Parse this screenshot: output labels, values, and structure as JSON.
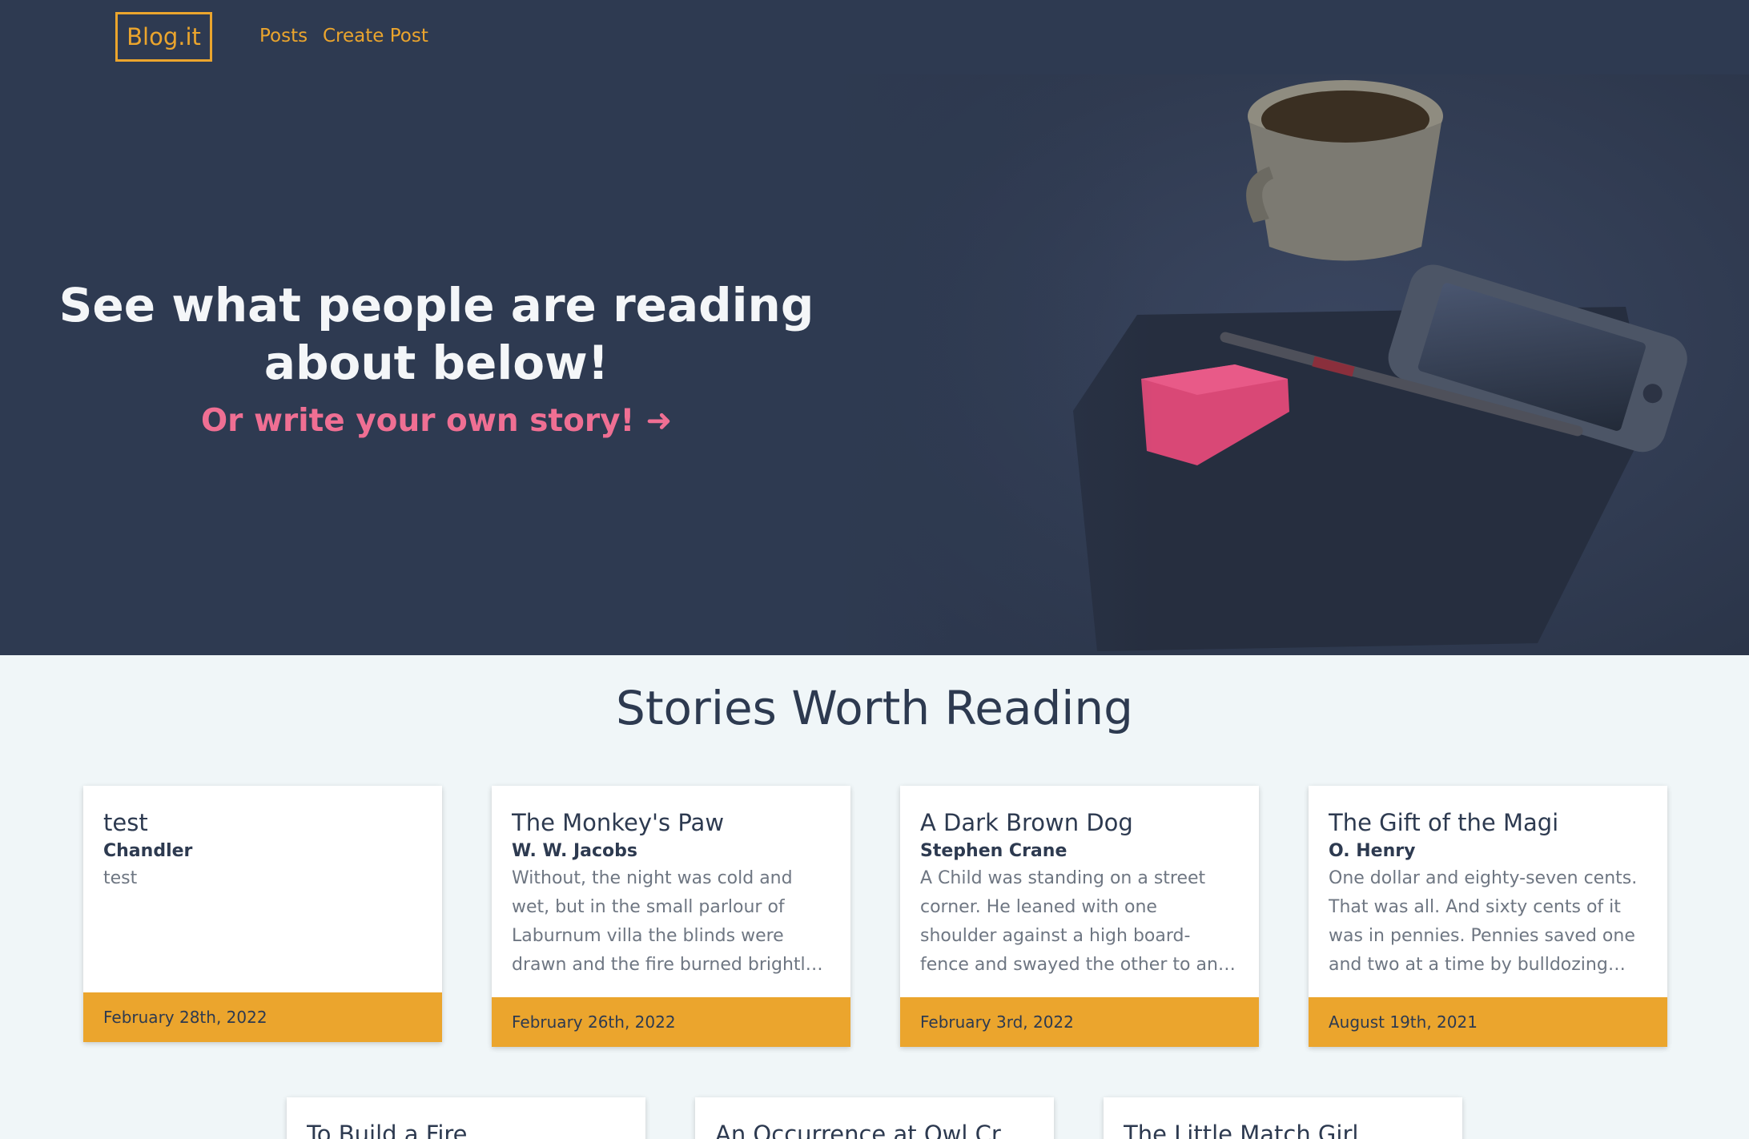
{
  "nav": {
    "brand": "Blog.it",
    "links": [
      "Posts",
      "Create Post"
    ]
  },
  "hero": {
    "title": "See what people are reading about below!",
    "cta": "Or write your own story!",
    "cta_icon": "arrow-right-icon"
  },
  "section": {
    "title": "Stories Worth Reading"
  },
  "posts": [
    {
      "title": "test",
      "author": "Chandler",
      "excerpt": "test",
      "date": "February 28th, 2022"
    },
    {
      "title": "The Monkey's Paw",
      "author": "W. W. Jacobs",
      "excerpt": "Without, the night was cold and wet, but in the small parlour of Laburnum villa the blinds were drawn and the fire burned brightly. Father and son...",
      "date": "February 26th, 2022"
    },
    {
      "title": "A Dark Brown Dog",
      "author": "Stephen Crane",
      "excerpt": "A Child was standing on a street corner. He leaned with one shoulder against a high board-fence and swayed the other to and fro, the...",
      "date": "February 3rd, 2022"
    },
    {
      "title": "The Gift of the Magi",
      "author": "O. Henry",
      "excerpt": "One dollar and eighty-seven cents. That was all. And sixty cents of it was in pennies. Pennies saved one and two at a time by bulldozing the...",
      "date": "August 19th, 2021"
    },
    {
      "title": "To Build a Fire"
    },
    {
      "title": "An Occurrence at Owl Cree..."
    },
    {
      "title": "The Little Match Girl"
    }
  ],
  "colors": {
    "navy": "#2e3a51",
    "accent": "#eba52d",
    "pink": "#ef6f93",
    "background": "#f0f6f8"
  }
}
